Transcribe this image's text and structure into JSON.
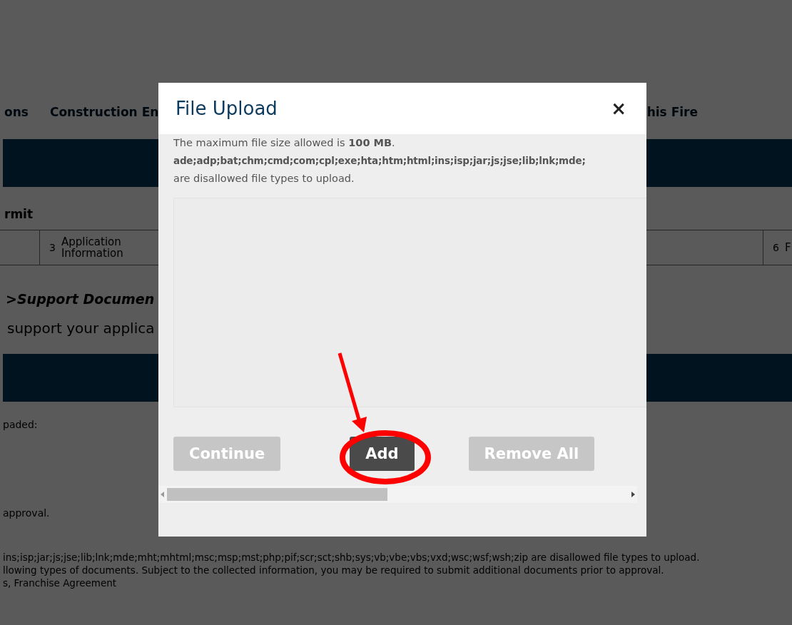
{
  "page": {
    "nav_tabs": [
      "ons",
      "Construction En",
      "his Fire"
    ],
    "section_title": "rmit",
    "steps": [
      {
        "number": "3",
        "label": "Application Information"
      },
      {
        "number": "6",
        "label": "F"
      }
    ],
    "breadcrumb": ">Support Documen",
    "intro": "support your applica",
    "uploaded_label": "paded:",
    "approval_note": "approval.",
    "footer_lines": [
      "ins;isp;jar;js;jse;lib;lnk;mde;mht;mhtml;msc;msp;mst;php;pif;scr;sct;shb;sys;vb;vbe;vbs;vxd;wsc;wsf;wsh;zip are disallowed file types to upload.",
      "llowing types of documents. Subject to the collected information, you may be required to submit additional documents prior to approval.",
      "s, Franchise Agreement"
    ]
  },
  "dialog": {
    "title": "File Upload",
    "close": "×",
    "size_note": "The maximum file size allowed is **100 MB**.",
    "disallowed_types": "ade;adp;bat;chm;cmd;com;cpl;exe;hta;htm;html;ins;isp;jar;js;jse;lib;lnk;mde;",
    "disallowed_note": "are disallowed file types to upload.",
    "buttons": [
      {
        "label": "Continue",
        "disabled": true
      },
      {
        "label": "Add",
        "disabled": false
      },
      {
        "label": "Remove All",
        "disabled": true
      }
    ]
  }
}
